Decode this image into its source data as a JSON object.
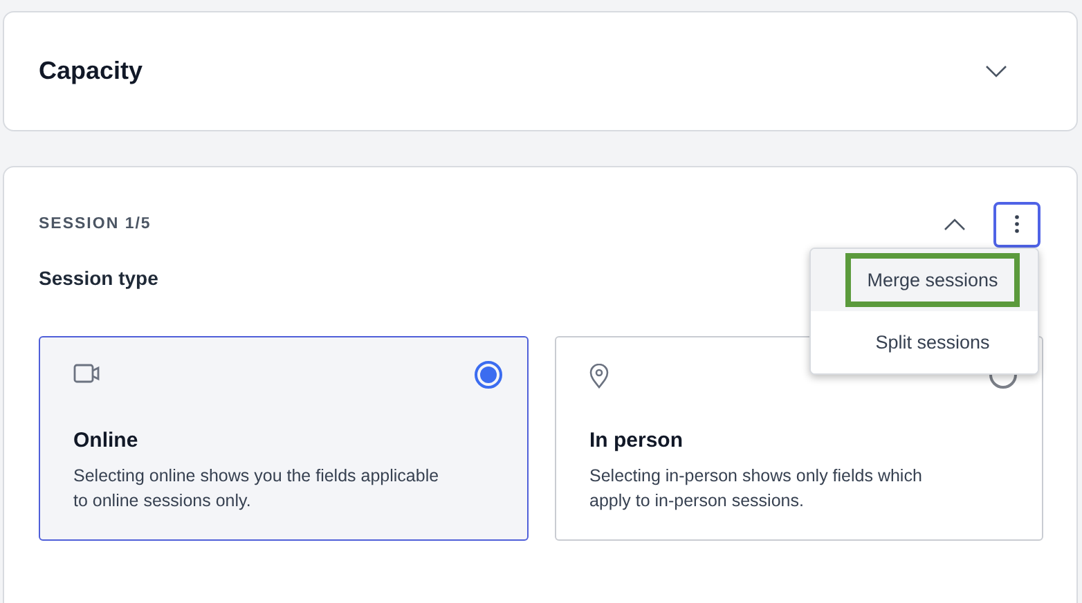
{
  "capacity": {
    "title": "Capacity",
    "expanded": false
  },
  "session": {
    "label": "SESSION 1/5",
    "expanded": true,
    "field_label": "Session type",
    "options": [
      {
        "kind": "online",
        "title": "Online",
        "description": "Selecting online shows you the fields applicable to online sessions only.",
        "selected": true
      },
      {
        "kind": "in_person",
        "title": "In person",
        "description": "Selecting in-person shows only fields which apply to in-person sessions.",
        "selected": false
      }
    ]
  },
  "menu": {
    "open": true,
    "items": [
      {
        "label": "Merge sessions",
        "highlighted": true
      },
      {
        "label": "Split sessions",
        "highlighted": false
      }
    ]
  }
}
